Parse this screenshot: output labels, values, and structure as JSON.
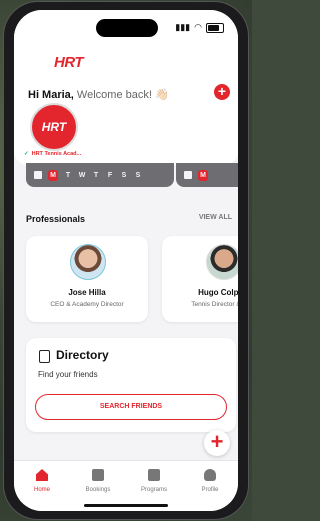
{
  "status": {
    "time": ""
  },
  "brand": {
    "logo_text": "HRT"
  },
  "header": {
    "greeting_name": "Hi Maria,",
    "greeting_sub": "Welcome back! 👋🏻",
    "add_button": "+"
  },
  "club": {
    "logo_text": "HRT",
    "name": "HRT Tennis Acad..."
  },
  "week": {
    "days": [
      "M",
      "T",
      "W",
      "T",
      "F",
      "S",
      "S"
    ],
    "active_day": "M",
    "second_strip_day": "M"
  },
  "professionals": {
    "title": "Professionals",
    "view_all": "VIEW ALL",
    "items": [
      {
        "name": "Jose Hilla",
        "role": "CEO & Academy Director"
      },
      {
        "name": "Hugo Colpan",
        "role": "Tennis Director & Gen"
      }
    ]
  },
  "directory": {
    "title": "Directory",
    "subtitle": "Find your friends",
    "button": "SEARCH FRIENDS"
  },
  "fab": "+",
  "tabs": [
    {
      "label": "Home",
      "icon": "home-icon",
      "active": true
    },
    {
      "label": "Bookings",
      "icon": "ticket-icon",
      "active": false
    },
    {
      "label": "Programs",
      "icon": "stack-icon",
      "active": false
    },
    {
      "label": "Profile",
      "icon": "person-icon",
      "active": false
    }
  ],
  "colors": {
    "accent": "#e3262e"
  }
}
